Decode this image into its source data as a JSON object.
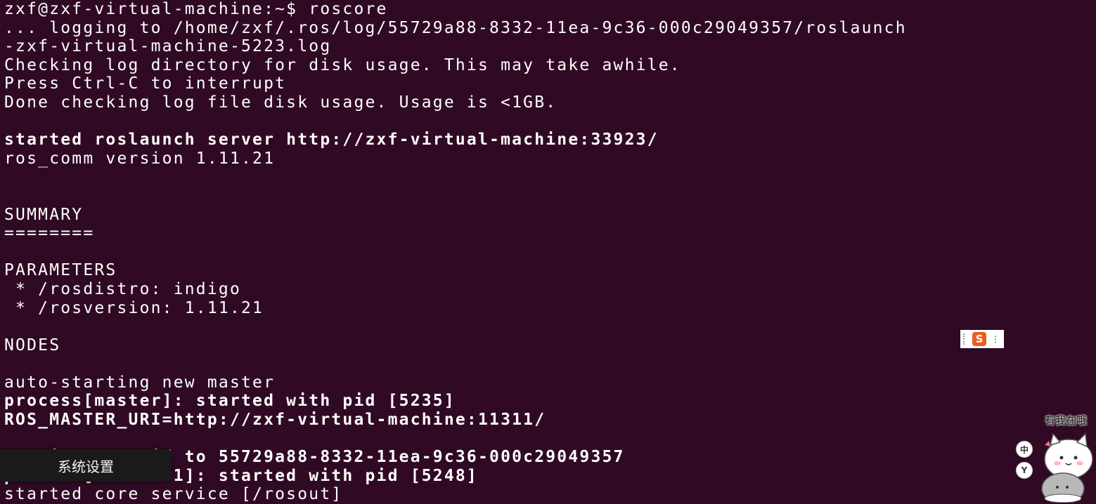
{
  "terminal": {
    "lines": [
      {
        "text": "zxf@zxf-virtual-machine:~$ roscore",
        "bold": false
      },
      {
        "text": "... logging to /home/zxf/.ros/log/55729a88-8332-11ea-9c36-000c29049357/roslaunch",
        "bold": false
      },
      {
        "text": "-zxf-virtual-machine-5223.log",
        "bold": false
      },
      {
        "text": "Checking log directory for disk usage. This may take awhile.",
        "bold": false
      },
      {
        "text": "Press Ctrl-C to interrupt",
        "bold": false
      },
      {
        "text": "Done checking log file disk usage. Usage is <1GB.",
        "bold": false
      },
      {
        "text": "",
        "bold": false
      },
      {
        "text": "started roslaunch server http://zxf-virtual-machine:33923/",
        "bold": true
      },
      {
        "text": "ros_comm version 1.11.21",
        "bold": false
      },
      {
        "text": "",
        "bold": false
      },
      {
        "text": "",
        "bold": false
      },
      {
        "text": "SUMMARY",
        "bold": false
      },
      {
        "text": "========",
        "bold": false
      },
      {
        "text": "",
        "bold": false
      },
      {
        "text": "PARAMETERS",
        "bold": false
      },
      {
        "text": " * /rosdistro: indigo",
        "bold": false
      },
      {
        "text": " * /rosversion: 1.11.21",
        "bold": false
      },
      {
        "text": "",
        "bold": false
      },
      {
        "text": "NODES",
        "bold": false
      },
      {
        "text": "",
        "bold": false
      },
      {
        "text": "auto-starting new master",
        "bold": false
      },
      {
        "text": "process[master]: started with pid [5235]",
        "bold": true
      },
      {
        "text": "ROS_MASTER_URI=http://zxf-virtual-machine:11311/",
        "bold": true
      },
      {
        "text": "",
        "bold": false
      },
      {
        "text": "setting /run_id to 55729a88-8332-11ea-9c36-000c29049357",
        "bold": true
      },
      {
        "text": "process[rosout-1]: started with pid [5248]",
        "bold": true
      },
      {
        "text": "started core service [/rosout]",
        "bold": false
      }
    ]
  },
  "ime_toolbar": {
    "logo": "S",
    "more": "⋮",
    "icon": "sogou-ime-icon"
  },
  "tooltip": {
    "label": "系统设置"
  },
  "widget": {
    "caption": "有我在哦",
    "btn1": "中",
    "btn2": "Y"
  },
  "colors": {
    "background": "#300a24",
    "text": "#ffffff",
    "ime_accent": "#ef5a1a"
  }
}
